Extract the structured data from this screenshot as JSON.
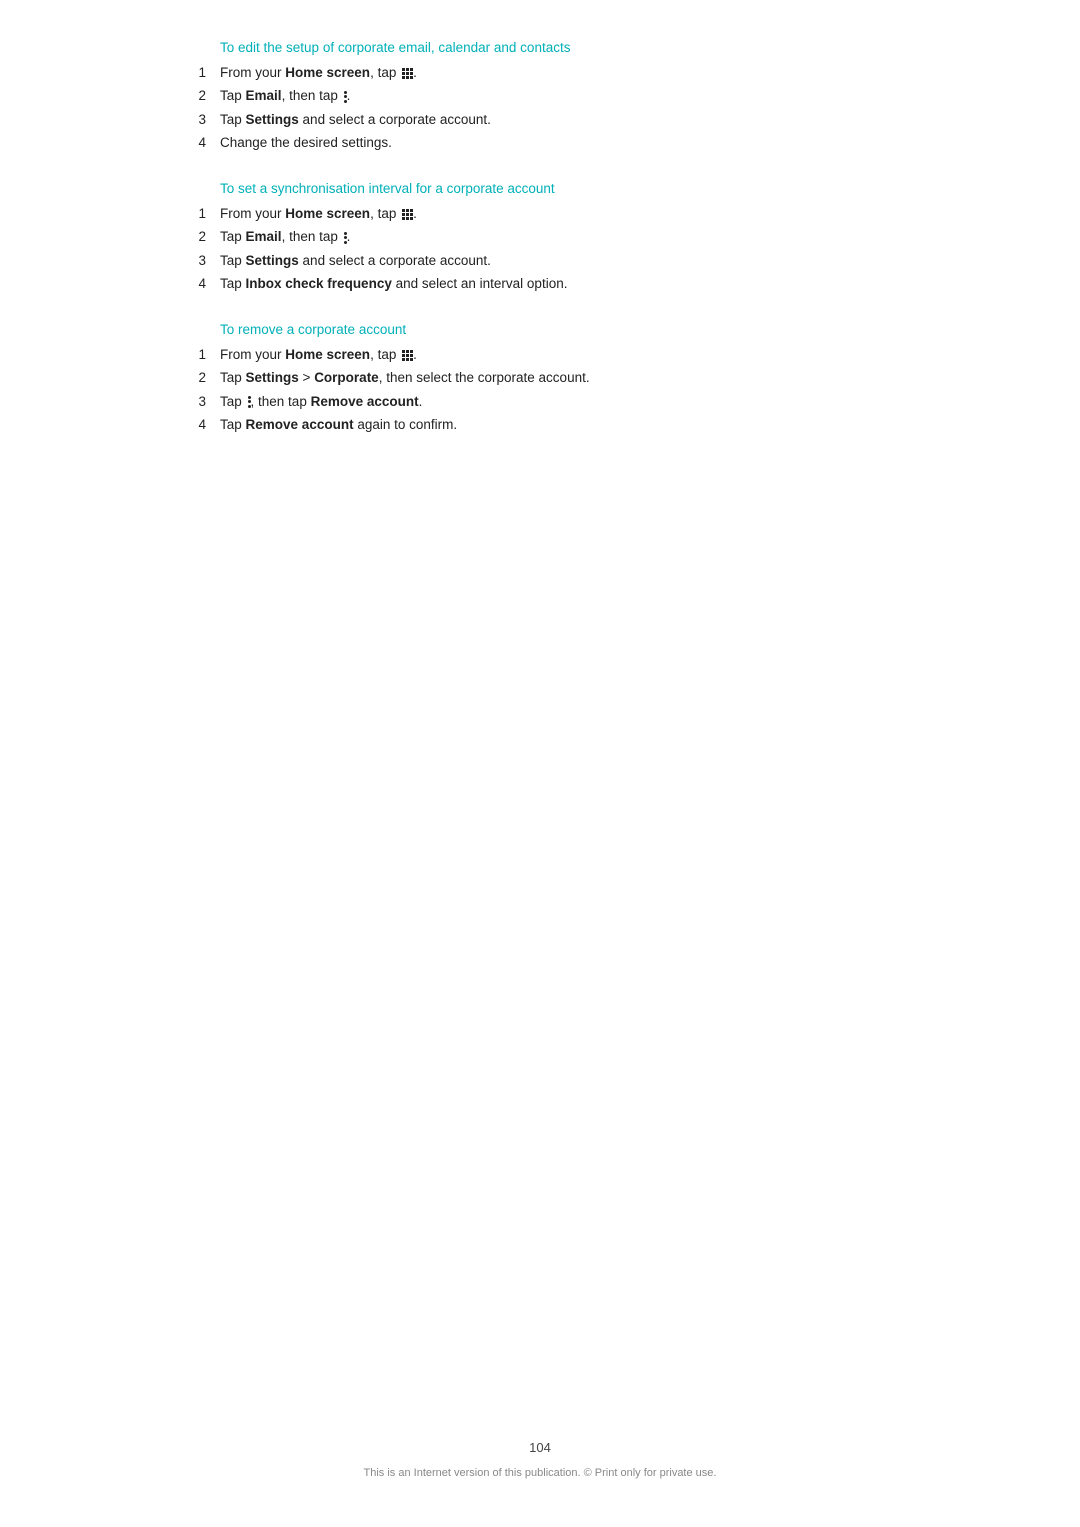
{
  "sections": [
    {
      "id": "edit-corporate",
      "title": "To edit the setup of corporate email, calendar and contacts",
      "steps": [
        {
          "num": "1",
          "parts": [
            {
              "text": "From your ",
              "bold": false
            },
            {
              "text": "Home screen",
              "bold": true
            },
            {
              "text": ", tap ",
              "bold": false
            },
            {
              "text": "GRID",
              "bold": false,
              "icon": "grid"
            },
            {
              "text": ".",
              "bold": false
            }
          ]
        },
        {
          "num": "2",
          "parts": [
            {
              "text": "Tap ",
              "bold": false
            },
            {
              "text": "Email",
              "bold": true
            },
            {
              "text": ", then tap ",
              "bold": false
            },
            {
              "text": "DOTS",
              "bold": false,
              "icon": "dots"
            },
            {
              "text": ".",
              "bold": false
            }
          ]
        },
        {
          "num": "3",
          "parts": [
            {
              "text": "Tap ",
              "bold": false
            },
            {
              "text": "Settings",
              "bold": true
            },
            {
              "text": " and select a corporate account.",
              "bold": false
            }
          ]
        },
        {
          "num": "4",
          "parts": [
            {
              "text": "Change the desired settings.",
              "bold": false
            }
          ]
        }
      ]
    },
    {
      "id": "sync-interval",
      "title": "To set a synchronisation interval for a corporate account",
      "steps": [
        {
          "num": "1",
          "parts": [
            {
              "text": "From your ",
              "bold": false
            },
            {
              "text": "Home screen",
              "bold": true
            },
            {
              "text": ", tap ",
              "bold": false
            },
            {
              "text": "GRID",
              "bold": false,
              "icon": "grid"
            },
            {
              "text": ".",
              "bold": false
            }
          ]
        },
        {
          "num": "2",
          "parts": [
            {
              "text": "Tap ",
              "bold": false
            },
            {
              "text": "Email",
              "bold": true
            },
            {
              "text": ", then tap ",
              "bold": false
            },
            {
              "text": "DOTS",
              "bold": false,
              "icon": "dots"
            },
            {
              "text": ".",
              "bold": false
            }
          ]
        },
        {
          "num": "3",
          "parts": [
            {
              "text": "Tap ",
              "bold": false
            },
            {
              "text": "Settings",
              "bold": true
            },
            {
              "text": " and select a corporate account.",
              "bold": false
            }
          ]
        },
        {
          "num": "4",
          "parts": [
            {
              "text": "Tap ",
              "bold": false
            },
            {
              "text": "Inbox check frequency",
              "bold": true
            },
            {
              "text": " and select an interval option.",
              "bold": false
            }
          ]
        }
      ]
    },
    {
      "id": "remove-account",
      "title": "To remove a corporate account",
      "steps": [
        {
          "num": "1",
          "parts": [
            {
              "text": "From your ",
              "bold": false
            },
            {
              "text": "Home screen",
              "bold": true
            },
            {
              "text": ", tap ",
              "bold": false
            },
            {
              "text": "GRID",
              "bold": false,
              "icon": "grid"
            },
            {
              "text": ".",
              "bold": false
            }
          ]
        },
        {
          "num": "2",
          "parts": [
            {
              "text": "Tap ",
              "bold": false
            },
            {
              "text": "Settings",
              "bold": true
            },
            {
              "text": " > ",
              "bold": false
            },
            {
              "text": "Corporate",
              "bold": true
            },
            {
              "text": ", then select the corporate account.",
              "bold": false
            }
          ]
        },
        {
          "num": "3",
          "parts": [
            {
              "text": "Tap ",
              "bold": false
            },
            {
              "text": "DOTS",
              "bold": false,
              "icon": "dots"
            },
            {
              "text": ", then tap ",
              "bold": false
            },
            {
              "text": "Remove account",
              "bold": true
            },
            {
              "text": ".",
              "bold": false
            }
          ]
        },
        {
          "num": "4",
          "parts": [
            {
              "text": "Tap ",
              "bold": false
            },
            {
              "text": "Remove account",
              "bold": true
            },
            {
              "text": " again to confirm.",
              "bold": false
            }
          ]
        }
      ]
    }
  ],
  "footer": {
    "page_number": "104",
    "note": "This is an Internet version of this publication. © Print only for private use."
  }
}
